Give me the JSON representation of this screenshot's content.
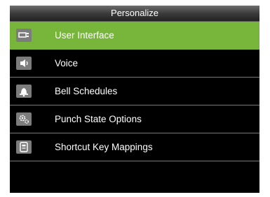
{
  "title": "Personalize",
  "menu": [
    {
      "label": "User Interface",
      "icon": "monitor-icon",
      "selected": true
    },
    {
      "label": "Voice",
      "icon": "speaker-icon",
      "selected": false
    },
    {
      "label": "Bell Schedules",
      "icon": "bell-icon",
      "selected": false
    },
    {
      "label": "Punch State Options",
      "icon": "gears-icon",
      "selected": false
    },
    {
      "label": "Shortcut Key Mappings",
      "icon": "keypad-icon",
      "selected": false
    }
  ],
  "colors": {
    "selected": "#78b53b",
    "background": "#000000",
    "text": "#ffffff"
  }
}
